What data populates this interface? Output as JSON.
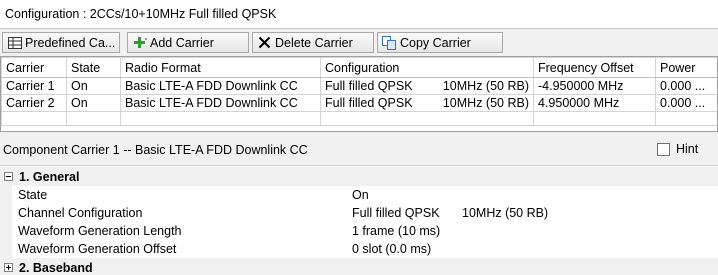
{
  "config_bar": {
    "text": "Configuration : 2CCs/10+10MHz Full filled QPSK"
  },
  "toolbar": {
    "predefined_label": "Predefined Ca...",
    "add_label": "Add Carrier",
    "delete_label": "Delete Carrier",
    "copy_label": "Copy Carrier"
  },
  "carrier_table": {
    "columns": [
      "Carrier",
      "State",
      "Radio Format",
      "Configuration",
      "Frequency Offset",
      "Power"
    ],
    "rows": [
      {
        "carrier": "Carrier 1",
        "state": "On",
        "radio_format": "Basic LTE-A FDD Downlink CC",
        "configuration": "Full filled QPSK",
        "bandwidth": "10MHz (50 RB)",
        "frequency_offset": "-4.950000 MHz",
        "power": "0.000 ..."
      },
      {
        "carrier": "Carrier 2",
        "state": "On",
        "radio_format": "Basic LTE-A FDD Downlink CC",
        "configuration": "Full filled QPSK",
        "bandwidth": "10MHz (50 RB)",
        "frequency_offset": "4.950000 MHz",
        "power": "0.000 ..."
      }
    ]
  },
  "component_carrier": {
    "title": "Component Carrier 1 -- Basic LTE-A FDD Downlink CC",
    "hint_label": "Hint",
    "hint_checked": false
  },
  "properties": {
    "general": {
      "label": "1. General",
      "rows": [
        {
          "name": "State",
          "value": "On",
          "value2": ""
        },
        {
          "name": "Channel Configuration",
          "value": "Full filled QPSK",
          "value2": "10MHz (50 RB)"
        },
        {
          "name": "Waveform Generation Length",
          "value": "1 frame (10 ms)",
          "value2": ""
        },
        {
          "name": "Waveform Generation Offset",
          "value": "0 slot (0.0 ms)",
          "value2": ""
        }
      ]
    },
    "baseband": {
      "label": "2. Baseband"
    }
  },
  "colors": {
    "add_icon": "#2e9e2e",
    "copy_icon": "#3a6fb0"
  }
}
